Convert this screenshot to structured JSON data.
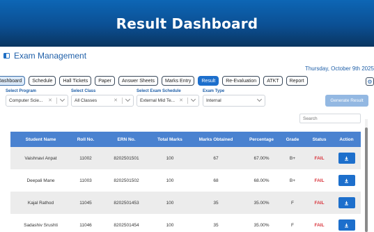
{
  "banner": {
    "title": "Result Dashboard"
  },
  "app": {
    "title": "Exam Management",
    "date": "Thursday, October 9th 2025"
  },
  "tabs": [
    {
      "label": "Dashboard"
    },
    {
      "label": "Schedule"
    },
    {
      "label": "Hall Tickets"
    },
    {
      "label": "Paper"
    },
    {
      "label": "Answer Sheets"
    },
    {
      "label": "Marks Entry"
    },
    {
      "label": "Result"
    },
    {
      "label": "Re-Evaluation"
    },
    {
      "label": "ATKT"
    },
    {
      "label": "Report"
    }
  ],
  "filters": {
    "program": {
      "label": "Select Program",
      "value": "Computer Scie..."
    },
    "class": {
      "label": "Select Class",
      "value": "All Classes"
    },
    "schedule": {
      "label": "Select Exam Schedule",
      "value": "External Mid Te..."
    },
    "exam_type": {
      "label": "Exam Type",
      "value": "Internal"
    }
  },
  "generate_button": "Generate Result",
  "search": {
    "placeholder": "Search"
  },
  "table": {
    "headers": [
      "Student Name",
      "Roll No.",
      "ERN No.",
      "Total Marks",
      "Marks Obtained",
      "Percentage",
      "Grade",
      "Status",
      "Action"
    ],
    "rows": [
      {
        "name": "Vaishnavi Anpat",
        "roll": "11002",
        "ern": "8202501501",
        "total": "100",
        "obtained": "67",
        "percentage": "67.00%",
        "grade": "B+",
        "status": "FAIL"
      },
      {
        "name": "Deepali Mane",
        "roll": "11003",
        "ern": "8202501502",
        "total": "100",
        "obtained": "68",
        "percentage": "68.00%",
        "grade": "B+",
        "status": "FAIL"
      },
      {
        "name": "Kajal Rathod",
        "roll": "11045",
        "ern": "8202501453",
        "total": "100",
        "obtained": "35",
        "percentage": "35.00%",
        "grade": "F",
        "status": "FAIL"
      },
      {
        "name": "Sadashiv Srushti",
        "roll": "11046",
        "ern": "8202501454",
        "total": "100",
        "obtained": "35",
        "percentage": "35.00%",
        "grade": "F",
        "status": "FAIL"
      }
    ]
  },
  "icons": {
    "action": "download-icon",
    "settings": "gear-icon",
    "sidebar": "sidebar-toggle-icon"
  },
  "colors": {
    "banner": "#0b4f93",
    "accent": "#1d6fcc",
    "table_header": "#4a82d0",
    "fail": "#d9363e"
  }
}
